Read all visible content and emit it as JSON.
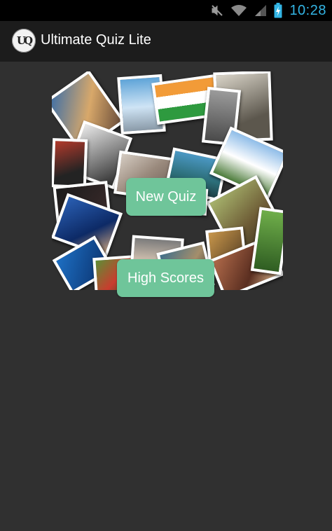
{
  "status_bar": {
    "time": "10:28",
    "icons": [
      "mute-icon",
      "wifi-icon",
      "signal-icon",
      "battery-charging-icon"
    ],
    "accent": "#33b5e5"
  },
  "app_bar": {
    "logo_text": "UQ",
    "title": "Ultimate Quiz Lite"
  },
  "menu": {
    "new_quiz_label": "New Quiz",
    "high_scores_label": "High Scores",
    "button_color": "#6fc59a"
  },
  "colors": {
    "background": "#303030",
    "action_bar": "#1c1c1c"
  }
}
